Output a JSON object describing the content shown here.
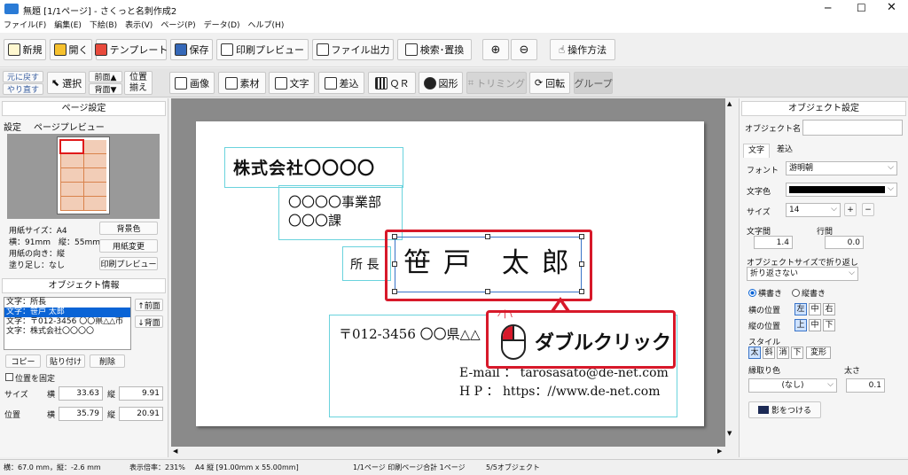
{
  "window": {
    "title": "無題 [1/1ページ] - さくっと名刺作成2",
    "app_icon": "app-icon"
  },
  "menu": [
    "ファイル(F)",
    "編集(E)",
    "下絵(B)",
    "表示(V)",
    "ページ(P)",
    "データ(D)",
    "ヘルプ(H)"
  ],
  "toolbar": {
    "new": "新規",
    "open": "開く",
    "template": "テンプレート",
    "save": "保存",
    "print_preview": "印刷プレビュー",
    "file_output": "ファイル出力",
    "search_replace": "検索･置換",
    "help": "操作方法"
  },
  "toolbar2": {
    "undo": "元に戻す",
    "redo": "やり直す",
    "select": "選択",
    "front": "前面▲",
    "back": "背面▼",
    "align1": "位置",
    "align2": "揃え",
    "image": "画像",
    "material": "素材",
    "text": "文字",
    "merge": "差込",
    "qr": "ＱＲ",
    "shape": "図形",
    "trim": "トリミング",
    "rotate": "回転",
    "group": "グループ"
  },
  "left": {
    "page_settings": "ページ設定",
    "tabs": [
      "設定",
      "ページプレビュー"
    ],
    "paper_size": "用紙サイズ：A4",
    "dims": "横：91mm　縦：55mm",
    "orientation": "用紙の向き：縦",
    "bleed": "塗り足し：なし",
    "bg_color": "背景色",
    "change_paper": "用紙変更",
    "print_preview": "印刷プレビュー",
    "obj_info": "オブジェクト情報",
    "objects": [
      "文字：所長",
      "文字：笹戸 太郎",
      "文字：〒012-3456 〇〇県△△市",
      "文字：株式会社〇〇〇〇"
    ],
    "front": "↑前面",
    "back": "↓背面",
    "copy": "コピー",
    "paste": "貼り付け",
    "delete": "削除",
    "fix_pos": "位置を固定",
    "size_label": "サイズ",
    "pos_label": "位置",
    "w": "横",
    "h": "縦",
    "size_w": "33.63",
    "size_h": "9.91",
    "pos_x": "35.79",
    "pos_y": "20.91"
  },
  "card": {
    "company": "株式会社〇〇〇〇",
    "dept1": "〇〇〇〇事業部",
    "dept2": "〇〇〇課",
    "title": "所 長",
    "name": "笹 戸　太 郎",
    "address": "〒012-3456 〇〇県△△",
    "email": "E-mail ： tarosasato@de-net.com",
    "hp": "H P ： https：//www.de-net.com",
    "callout": "ダブルクリック"
  },
  "right": {
    "obj_settings": "オブジェクト設定",
    "obj_name": "オブジェクト名",
    "tabs": [
      "文字",
      "差込"
    ],
    "font_label": "フォント",
    "font": "游明朝",
    "color_label": "文字色",
    "size_label": "サイズ",
    "size": "14",
    "char_spacing": "文字間",
    "char_val": "1.4",
    "line_spacing": "行間",
    "line_val": "0.0",
    "wrap_label": "オブジェクトサイズで折り返し",
    "wrap": "折り返さない",
    "horizontal": "横書き",
    "vertical": "縦書き",
    "hpos": "横の位置",
    "hopts": [
      "左",
      "中",
      "右"
    ],
    "vpos": "縦の位置",
    "vopts": [
      "上",
      "中",
      "下"
    ],
    "style": "スタイル",
    "styles": [
      "太",
      "斜",
      "消",
      "下",
      "変形"
    ],
    "border_color": "縁取り色",
    "border_val": "(なし)",
    "thickness": "太さ",
    "thick_val": "0.1",
    "shadow": "影をつける"
  },
  "status": {
    "coords": "横：67.0 mm，縦：-2.6 mm",
    "zoom": "表示倍率：231%",
    "paper": "A4 縦 [91.00mm x 55.00mm]",
    "pages": "1/1ページ 印刷ページ合計 1ページ",
    "objs": "5/5オブジェクト"
  },
  "colors": {
    "accent": "#d7192a",
    "frame": "#6ad3dd",
    "select": "#3a74c8"
  }
}
